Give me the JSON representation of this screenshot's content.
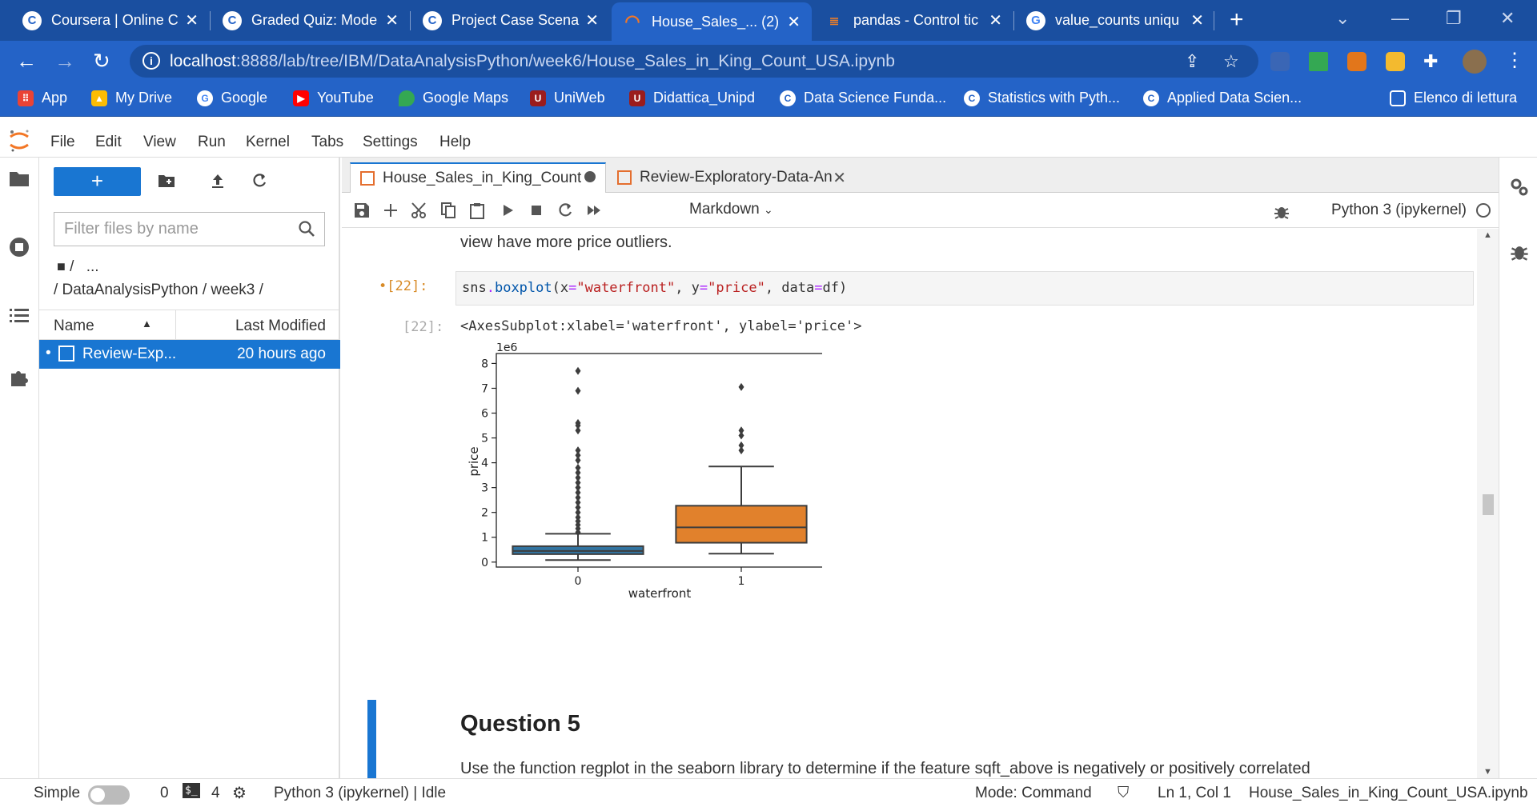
{
  "browser": {
    "tabs": [
      {
        "title": "Coursera | Online C",
        "icon": "coursera-icon",
        "active": false
      },
      {
        "title": "Graded Quiz: Mode",
        "icon": "coursera-icon",
        "active": false
      },
      {
        "title": "Project Case Scenar",
        "icon": "coursera-icon",
        "active": false
      },
      {
        "title": "House_Sales_... (2)",
        "icon": "jupyter-icon",
        "active": true
      },
      {
        "title": "pandas - Control tic",
        "icon": "stackoverflow-icon",
        "active": false
      },
      {
        "title": "value_counts uniqu",
        "icon": "google-icon",
        "active": false
      }
    ],
    "url_host": "localhost",
    "url_path": ":8888/lab/tree/IBM/DataAnalysisPython/week6/House_Sales_in_King_Count_USA.ipynb",
    "bookmarks": [
      {
        "label": "App",
        "icon": "apps-grid-icon",
        "color": "#ea4335"
      },
      {
        "label": "My Drive",
        "icon": "drive-icon",
        "color": "#fbbc04"
      },
      {
        "label": "Google",
        "icon": "google-icon",
        "color": "#ffffff"
      },
      {
        "label": "YouTube",
        "icon": "youtube-icon",
        "color": "#ff0000"
      },
      {
        "label": "Google Maps",
        "icon": "maps-pin-icon",
        "color": "#34a853"
      },
      {
        "label": "UniWeb",
        "icon": "unipd-icon",
        "color": "#9b1c1c"
      },
      {
        "label": "Didattica_Unipd",
        "icon": "unipd-icon",
        "color": "#9b1c1c"
      },
      {
        "label": "Data Science Funda...",
        "icon": "coursera-icon",
        "color": "#ffffff"
      },
      {
        "label": "Statistics with Pyth...",
        "icon": "coursera-icon",
        "color": "#ffffff"
      },
      {
        "label": "Applied Data Scien...",
        "icon": "coursera-icon",
        "color": "#ffffff"
      }
    ],
    "reading_list": "Elenco di lettura"
  },
  "jupyter": {
    "menu": [
      "File",
      "Edit",
      "View",
      "Run",
      "Kernel",
      "Tabs",
      "Settings",
      "Help"
    ],
    "filebrowser": {
      "filter_placeholder": "Filter files by name",
      "crumb_root": "/",
      "crumb_more": "...",
      "crumb_path": "/ DataAnalysisPython / week3 /",
      "col_name": "Name",
      "col_modified": "Last Modified",
      "files": [
        {
          "name": "Review-Exp...",
          "modified": "20 hours ago"
        }
      ]
    },
    "doc_tabs": [
      {
        "title": "House_Sales_in_King_Count_",
        "active": true,
        "dirty": true
      },
      {
        "title": "Review-Exploratory-Data-An",
        "active": false,
        "dirty": false
      }
    ],
    "toolbar": {
      "cell_type": "Markdown",
      "kernel": "Python 3 (ipykernel)"
    },
    "notebook": {
      "text_top": "view have more price outliers.",
      "in_prompt": "•[22]:",
      "code": {
        "p1": "sns",
        "p2": ".",
        "p3": "boxplot",
        "p4": "(x",
        "p5": "=",
        "p6": "\"waterfront\"",
        "p7": ", y",
        "p8": "=",
        "p9": "\"price\"",
        "p10": ", data",
        "p11": "=",
        "p12": "df)"
      },
      "out_prompt": "[22]:",
      "out_text": "<AxesSubplot:xlabel='waterfront', ylabel='price'>",
      "question_heading": "Question 5",
      "partial_text": "Use the function  regplot  in the seaborn library to determine if the feature  sqft_above  is negatively or positively correlated"
    },
    "status": {
      "mode_label": "Simple",
      "terminals": "0",
      "kernels": "4",
      "kernel_status": "Python 3 (ipykernel) | Idle",
      "mode": "Mode: Command",
      "cursor": "Ln 1, Col 1",
      "filename": "House_Sales_in_King_Count_USA.ipynb"
    }
  },
  "chart_data": {
    "type": "box",
    "xlabel": "waterfront",
    "ylabel": "price",
    "scale_label": "1e6",
    "categories": [
      "0",
      "1"
    ],
    "ylim": [
      -0.2,
      8.4
    ],
    "yticks": [
      "0",
      "1",
      "2",
      "3",
      "4",
      "5",
      "6",
      "7",
      "8"
    ],
    "colors": [
      "#3274a1",
      "#e1812c"
    ],
    "boxes": [
      {
        "category": "0",
        "whisker_low": 0.08,
        "q1": 0.32,
        "median": 0.45,
        "q3": 0.64,
        "whisker_high": 1.14,
        "outliers": [
          1.2,
          1.35,
          1.5,
          1.65,
          1.8,
          2.0,
          2.2,
          2.4,
          2.6,
          2.8,
          3.0,
          3.2,
          3.4,
          3.6,
          3.8,
          4.1,
          4.3,
          4.5,
          5.3,
          5.5,
          5.6,
          6.9,
          7.7
        ]
      },
      {
        "category": "1",
        "whisker_low": 0.34,
        "q1": 0.78,
        "median": 1.4,
        "q3": 2.27,
        "whisker_high": 3.85,
        "outliers": [
          4.5,
          4.7,
          5.1,
          5.3,
          7.05
        ]
      }
    ]
  }
}
